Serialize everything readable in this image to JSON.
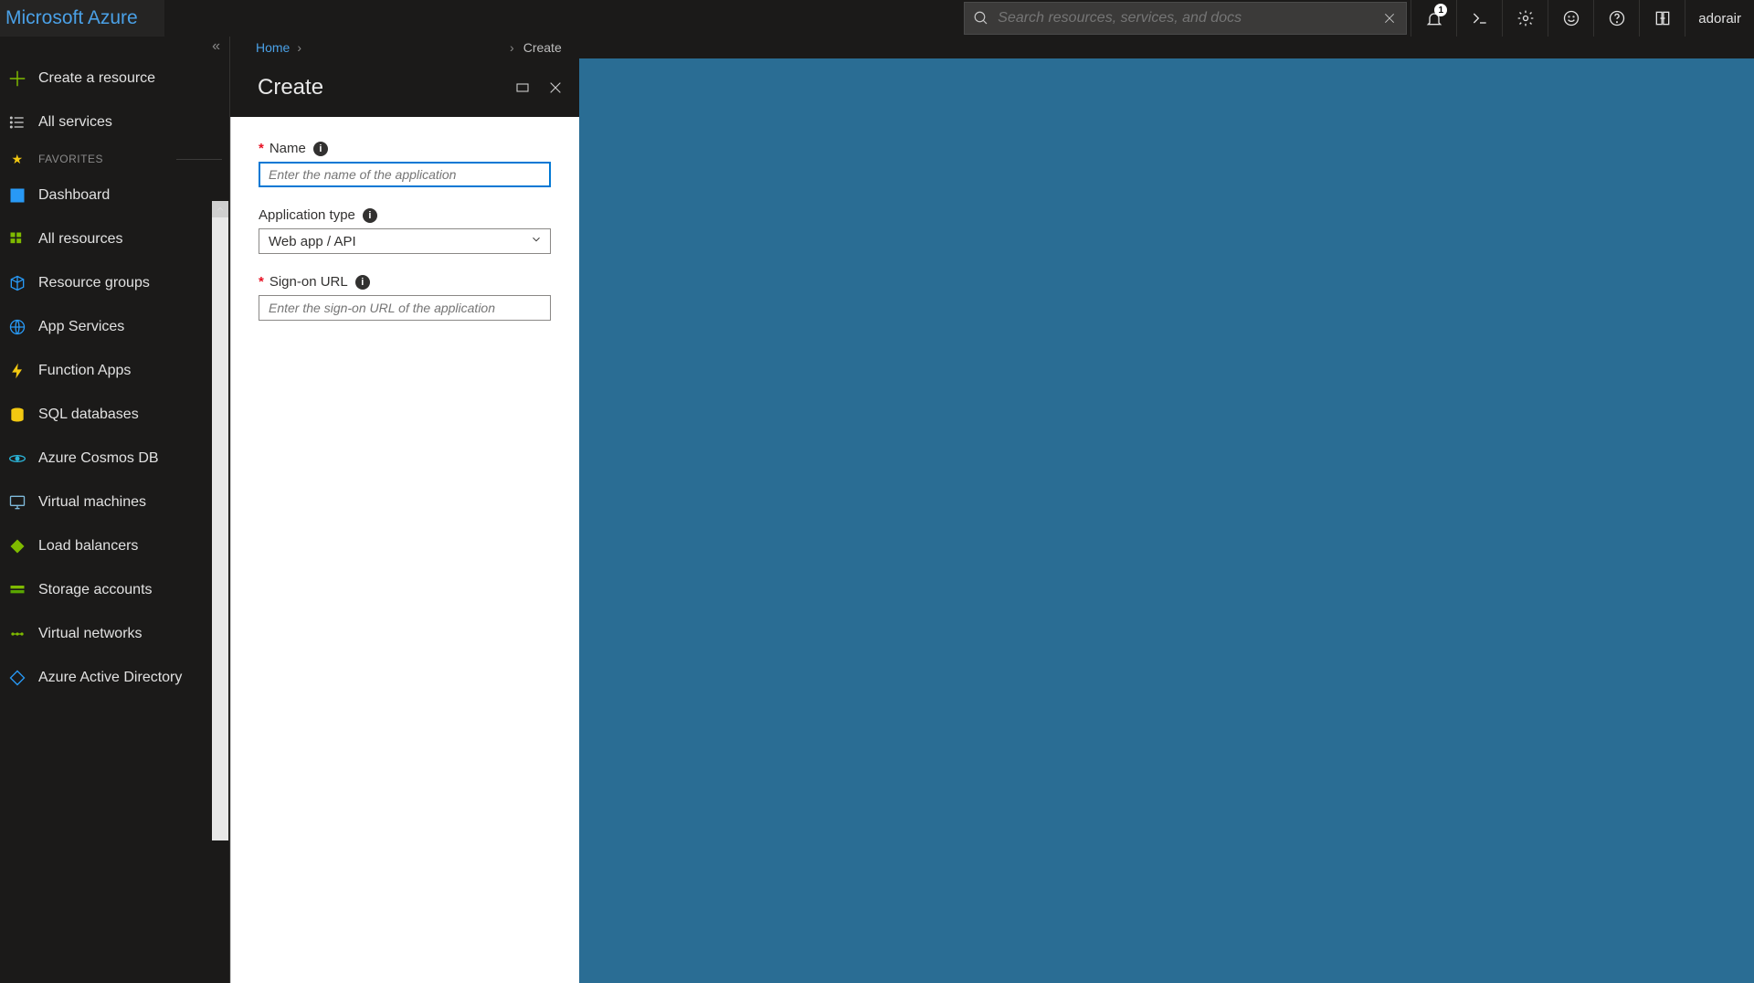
{
  "brand": "Microsoft Azure",
  "search": {
    "placeholder": "Search resources, services, and docs"
  },
  "notifications": {
    "count": "1"
  },
  "account": {
    "name": "adorair"
  },
  "breadcrumb": {
    "home": "Home",
    "current": "Create"
  },
  "sidebar": {
    "collapse_glyph": "«",
    "create_resource": "Create a resource",
    "all_services": "All services",
    "favorites_header": "FAVORITES",
    "items": [
      {
        "label": "Dashboard",
        "icon": "dashboard",
        "color": "#2899f5"
      },
      {
        "label": "All resources",
        "icon": "grid",
        "color": "#7fba00"
      },
      {
        "label": "Resource groups",
        "icon": "cube",
        "color": "#2899f5"
      },
      {
        "label": "App Services",
        "icon": "globe",
        "color": "#2899f5"
      },
      {
        "label": "Function Apps",
        "icon": "bolt",
        "color": "#f2c811"
      },
      {
        "label": "SQL databases",
        "icon": "database",
        "color": "#f2c811"
      },
      {
        "label": "Azure Cosmos DB",
        "icon": "orbit",
        "color": "#2bb4d8"
      },
      {
        "label": "Virtual machines",
        "icon": "monitor",
        "color": "#7fbadb"
      },
      {
        "label": "Load balancers",
        "icon": "diamond",
        "color": "#7fba00"
      },
      {
        "label": "Storage accounts",
        "icon": "storage",
        "color": "#7fba00"
      },
      {
        "label": "Virtual networks",
        "icon": "network",
        "color": "#7fba00"
      },
      {
        "label": "Azure Active Directory",
        "icon": "aad",
        "color": "#2899f5"
      }
    ]
  },
  "blade": {
    "title": "Create",
    "fields": {
      "name_label": "Name",
      "name_placeholder": "Enter the name of the application",
      "apptype_label": "Application type",
      "apptype_value": "Web app / API",
      "signon_label": "Sign-on URL",
      "signon_placeholder": "Enter the sign-on URL of the application"
    }
  }
}
